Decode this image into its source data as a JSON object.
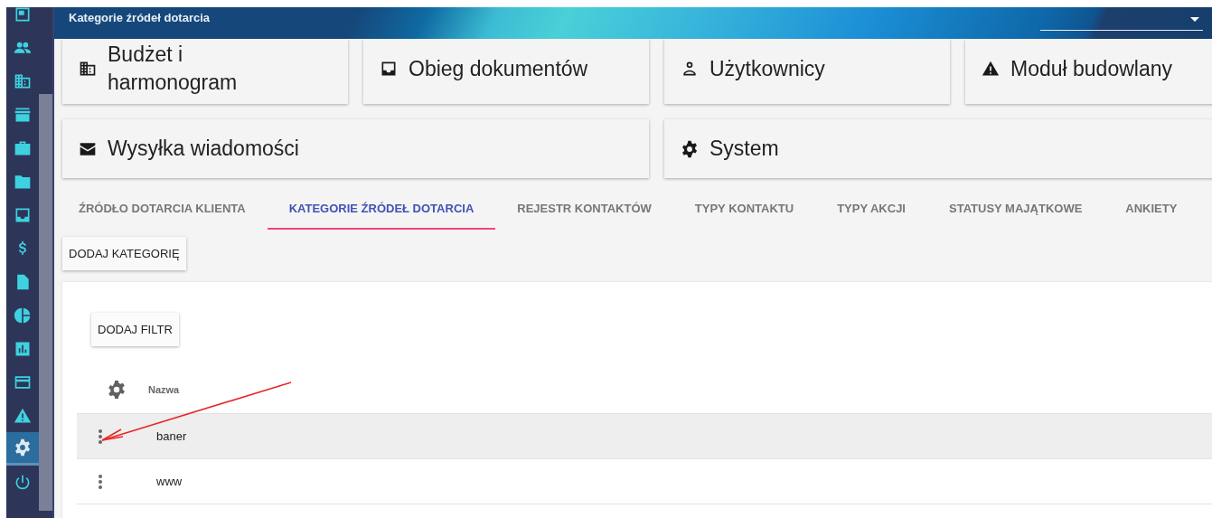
{
  "sidebar": {
    "items": [
      {
        "kind": "screen",
        "selected": false
      },
      {
        "kind": "people",
        "selected": false
      },
      {
        "kind": "building",
        "selected": false
      },
      {
        "kind": "store",
        "selected": false
      },
      {
        "kind": "briefcase",
        "selected": false
      },
      {
        "kind": "folder",
        "selected": false
      },
      {
        "kind": "inbox",
        "selected": false
      },
      {
        "kind": "dollar",
        "selected": false
      },
      {
        "kind": "document",
        "selected": false
      },
      {
        "kind": "pie",
        "selected": false
      },
      {
        "kind": "chart",
        "selected": false
      },
      {
        "kind": "card",
        "selected": false
      },
      {
        "kind": "warning",
        "selected": false
      },
      {
        "kind": "gear",
        "selected": true
      },
      {
        "kind": "power",
        "selected": false
      }
    ]
  },
  "header": {
    "title": "Kategorie źródeł dotarcia"
  },
  "modules": [
    {
      "kind": "building",
      "label": "Budżet i harmonogram"
    },
    {
      "kind": "inbox",
      "label": "Obieg dokumentów"
    },
    {
      "kind": "person",
      "label": "Użytkownicy"
    },
    {
      "kind": "warning",
      "label": "Moduł budowlany"
    },
    {
      "kind": "mail",
      "label": "Wysyłka wiadomości"
    },
    {
      "kind": "gear",
      "label": "System"
    }
  ],
  "tabs": [
    {
      "label": "ŹRÓDŁO DOTARCIA KLIENTA",
      "selected": false
    },
    {
      "label": "KATEGORIE ŹRÓDEŁ DOTARCIA",
      "selected": true
    },
    {
      "label": "REJESTR KONTAKTÓW",
      "selected": false
    },
    {
      "label": "TYPY KONTAKTU",
      "selected": false
    },
    {
      "label": "TYPY AKCJI",
      "selected": false
    },
    {
      "label": "STATUSY MAJĄTKOWE",
      "selected": false
    },
    {
      "label": "ANKIETY",
      "selected": false
    }
  ],
  "add_button": "DODAJ KATEGORIĘ",
  "filter_button": "DODAJ FILTR",
  "table": {
    "columns": [
      "Nazwa"
    ],
    "rows": [
      {
        "name": "baner",
        "selected": true
      },
      {
        "name": "www",
        "selected": false
      }
    ]
  }
}
